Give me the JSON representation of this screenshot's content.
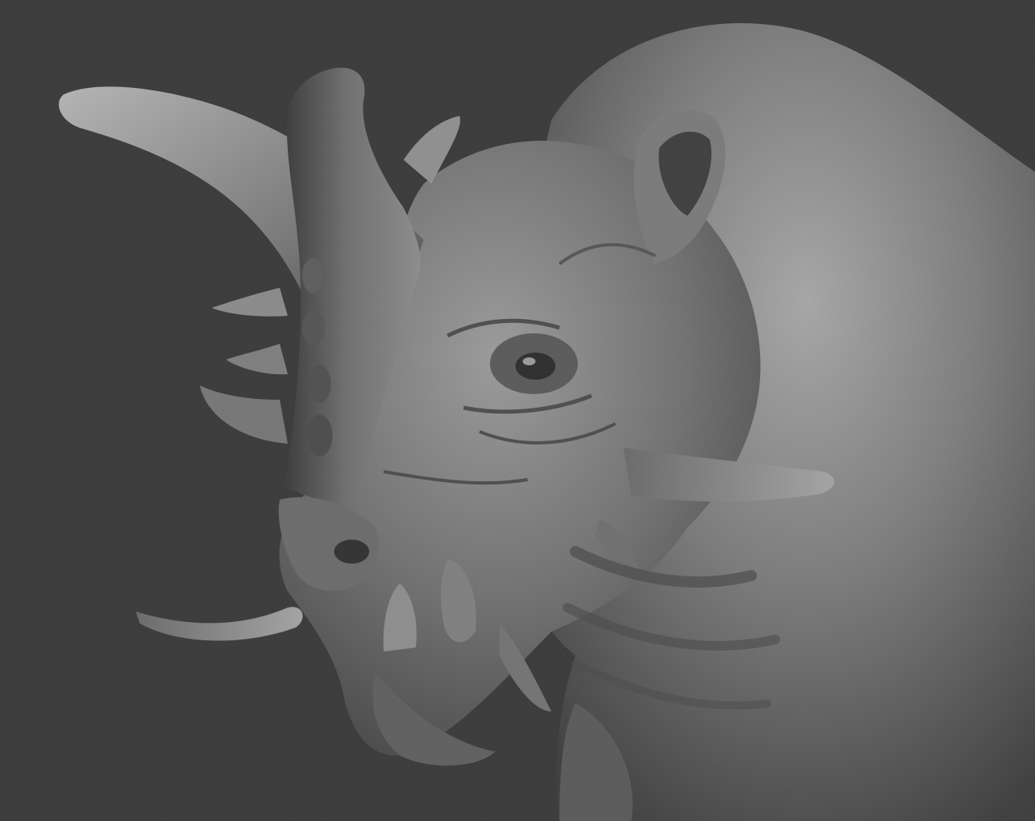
{
  "scene": {
    "subject_icon": "creature-sculpt-icon",
    "background_color": "#3a3a3a",
    "material_color": "#8a8a8a",
    "shadow_color": "#2a2a2a",
    "highlight_color": "#c8c8c8"
  }
}
